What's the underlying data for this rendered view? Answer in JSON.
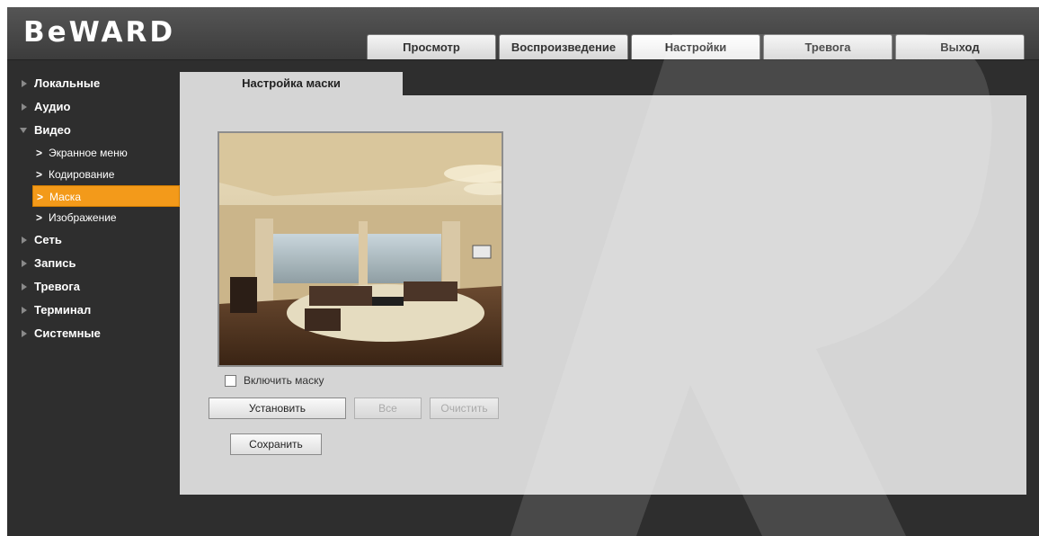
{
  "app": {
    "logo": "BeWARD"
  },
  "tabs": [
    {
      "label": "Просмотр",
      "active": false
    },
    {
      "label": "Воспроизведение",
      "active": false
    },
    {
      "label": "Настройки",
      "active": true
    },
    {
      "label": "Тревога",
      "active": false
    },
    {
      "label": "Выход",
      "active": false
    }
  ],
  "sidebar": {
    "local": "Локальные",
    "audio": "Аудио",
    "video": "Видео",
    "video_items": {
      "osd": "Экранное меню",
      "encoding": "Кодирование",
      "mask": "Маска",
      "image": "Изображение"
    },
    "network": "Сеть",
    "record": "Запись",
    "alarm": "Тревога",
    "terminal": "Терминал",
    "system": "Системные"
  },
  "main": {
    "tab_title": "Настройка маски",
    "enable_mask_label": "Включить маску",
    "enable_mask_checked": false,
    "buttons": {
      "set": "Установить",
      "all": "Все",
      "clear": "Очистить",
      "save": "Сохранить"
    }
  },
  "colors": {
    "accent": "#f39a1a",
    "panel": "#d5d5d5",
    "background": "#2e2e2e"
  }
}
